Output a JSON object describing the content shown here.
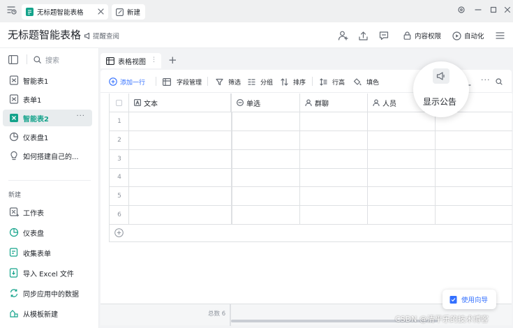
{
  "tabs": {
    "active": "无标题智能表格",
    "new": "新建"
  },
  "header": {
    "title": "无标题智能表格",
    "reminder": "提醒查阅",
    "permission": "内容权限",
    "automation": "自动化"
  },
  "sidebar": {
    "search_placeholder": "搜索",
    "items": [
      {
        "label": "智能表1",
        "icon": "smart-sheet-icon"
      },
      {
        "label": "表单1",
        "icon": "form-icon"
      },
      {
        "label": "智能表2",
        "icon": "smart-sheet-icon",
        "active": true
      },
      {
        "label": "仪表盘1",
        "icon": "dashboard-icon"
      },
      {
        "label": "如何搭建自己的...",
        "icon": "lightbulb-icon"
      }
    ],
    "new_section": "新建",
    "new_items": [
      {
        "label": "工作表",
        "icon": "worksheet-icon"
      },
      {
        "label": "仪表盘",
        "icon": "dashboard-icon"
      },
      {
        "label": "收集表单",
        "icon": "collect-form-icon"
      },
      {
        "label": "导入 Excel 文件",
        "icon": "import-icon"
      },
      {
        "label": "同步应用中的数据",
        "icon": "sync-icon"
      },
      {
        "label": "从模板新建",
        "icon": "template-icon"
      }
    ],
    "more": "···"
  },
  "view": {
    "tab_label": "表格视图",
    "add_view": "+"
  },
  "toolbar": {
    "add_row": "添加一行",
    "fields": "字段管理",
    "filter": "筛选",
    "group": "分组",
    "sort": "排序",
    "row_height": "行高",
    "fill": "填色"
  },
  "table": {
    "columns": [
      {
        "label": "文本",
        "icon": "text-field-icon"
      },
      {
        "label": "单选",
        "icon": "single-select-icon"
      },
      {
        "label": "群聊",
        "icon": "group-chat-icon"
      },
      {
        "label": "人员",
        "icon": "person-icon"
      }
    ],
    "rows": [
      "1",
      "2",
      "3",
      "4",
      "5",
      "6"
    ],
    "total_label": "总数 6"
  },
  "callout": {
    "label": "显示公告"
  },
  "guide": {
    "label": "使用向导"
  },
  "watermark": "CSDN @清平乐的技术博客",
  "colors": {
    "accent": "#14a38b",
    "link": "#3370ff",
    "border": "#dee0e3"
  }
}
